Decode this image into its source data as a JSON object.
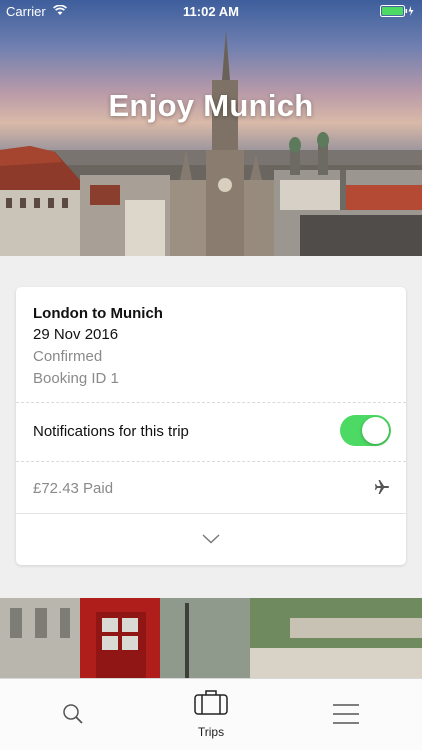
{
  "status_bar": {
    "carrier": "Carrier",
    "time": "11:02 AM",
    "battery_color": "#4cd964"
  },
  "hero": {
    "title": "Enjoy Munich"
  },
  "trip": {
    "route": "London to Munich",
    "date": "29 Nov 2016",
    "status": "Confirmed",
    "booking_id": "Booking ID 1",
    "notifications_label": "Notifications for this trip",
    "notifications_enabled": true,
    "price_paid": "£72.43 Paid",
    "mode_icon": "plane-icon",
    "expand_icon": "chevron-down-icon"
  },
  "tab_bar": {
    "items": [
      {
        "label": "",
        "icon": "search-icon"
      },
      {
        "label": "Trips",
        "icon": "suitcase-icon"
      },
      {
        "label": "",
        "icon": "menu-icon"
      }
    ]
  },
  "colors": {
    "toggle_on": "#4cd964",
    "background": "#efeff0",
    "secondary_text": "#8a8a8a"
  }
}
